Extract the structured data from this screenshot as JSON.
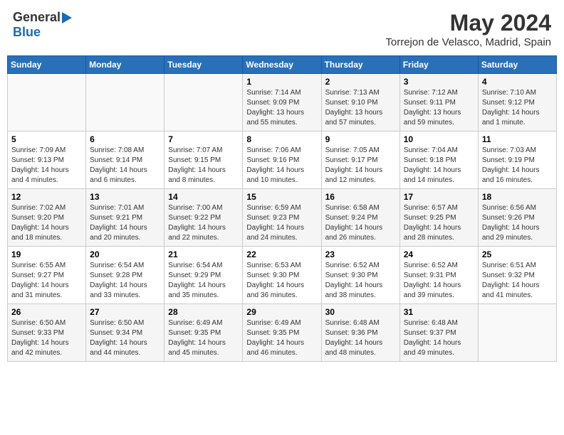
{
  "header": {
    "logo_general": "General",
    "logo_blue": "Blue",
    "month": "May 2024",
    "location": "Torrejon de Velasco, Madrid, Spain"
  },
  "weekdays": [
    "Sunday",
    "Monday",
    "Tuesday",
    "Wednesday",
    "Thursday",
    "Friday",
    "Saturday"
  ],
  "weeks": [
    [
      {
        "day": "",
        "info": ""
      },
      {
        "day": "",
        "info": ""
      },
      {
        "day": "",
        "info": ""
      },
      {
        "day": "1",
        "info": "Sunrise: 7:14 AM\nSunset: 9:09 PM\nDaylight: 13 hours and 55 minutes."
      },
      {
        "day": "2",
        "info": "Sunrise: 7:13 AM\nSunset: 9:10 PM\nDaylight: 13 hours and 57 minutes."
      },
      {
        "day": "3",
        "info": "Sunrise: 7:12 AM\nSunset: 9:11 PM\nDaylight: 13 hours and 59 minutes."
      },
      {
        "day": "4",
        "info": "Sunrise: 7:10 AM\nSunset: 9:12 PM\nDaylight: 14 hours and 1 minute."
      }
    ],
    [
      {
        "day": "5",
        "info": "Sunrise: 7:09 AM\nSunset: 9:13 PM\nDaylight: 14 hours and 4 minutes."
      },
      {
        "day": "6",
        "info": "Sunrise: 7:08 AM\nSunset: 9:14 PM\nDaylight: 14 hours and 6 minutes."
      },
      {
        "day": "7",
        "info": "Sunrise: 7:07 AM\nSunset: 9:15 PM\nDaylight: 14 hours and 8 minutes."
      },
      {
        "day": "8",
        "info": "Sunrise: 7:06 AM\nSunset: 9:16 PM\nDaylight: 14 hours and 10 minutes."
      },
      {
        "day": "9",
        "info": "Sunrise: 7:05 AM\nSunset: 9:17 PM\nDaylight: 14 hours and 12 minutes."
      },
      {
        "day": "10",
        "info": "Sunrise: 7:04 AM\nSunset: 9:18 PM\nDaylight: 14 hours and 14 minutes."
      },
      {
        "day": "11",
        "info": "Sunrise: 7:03 AM\nSunset: 9:19 PM\nDaylight: 14 hours and 16 minutes."
      }
    ],
    [
      {
        "day": "12",
        "info": "Sunrise: 7:02 AM\nSunset: 9:20 PM\nDaylight: 14 hours and 18 minutes."
      },
      {
        "day": "13",
        "info": "Sunrise: 7:01 AM\nSunset: 9:21 PM\nDaylight: 14 hours and 20 minutes."
      },
      {
        "day": "14",
        "info": "Sunrise: 7:00 AM\nSunset: 9:22 PM\nDaylight: 14 hours and 22 minutes."
      },
      {
        "day": "15",
        "info": "Sunrise: 6:59 AM\nSunset: 9:23 PM\nDaylight: 14 hours and 24 minutes."
      },
      {
        "day": "16",
        "info": "Sunrise: 6:58 AM\nSunset: 9:24 PM\nDaylight: 14 hours and 26 minutes."
      },
      {
        "day": "17",
        "info": "Sunrise: 6:57 AM\nSunset: 9:25 PM\nDaylight: 14 hours and 28 minutes."
      },
      {
        "day": "18",
        "info": "Sunrise: 6:56 AM\nSunset: 9:26 PM\nDaylight: 14 hours and 29 minutes."
      }
    ],
    [
      {
        "day": "19",
        "info": "Sunrise: 6:55 AM\nSunset: 9:27 PM\nDaylight: 14 hours and 31 minutes."
      },
      {
        "day": "20",
        "info": "Sunrise: 6:54 AM\nSunset: 9:28 PM\nDaylight: 14 hours and 33 minutes."
      },
      {
        "day": "21",
        "info": "Sunrise: 6:54 AM\nSunset: 9:29 PM\nDaylight: 14 hours and 35 minutes."
      },
      {
        "day": "22",
        "info": "Sunrise: 6:53 AM\nSunset: 9:30 PM\nDaylight: 14 hours and 36 minutes."
      },
      {
        "day": "23",
        "info": "Sunrise: 6:52 AM\nSunset: 9:30 PM\nDaylight: 14 hours and 38 minutes."
      },
      {
        "day": "24",
        "info": "Sunrise: 6:52 AM\nSunset: 9:31 PM\nDaylight: 14 hours and 39 minutes."
      },
      {
        "day": "25",
        "info": "Sunrise: 6:51 AM\nSunset: 9:32 PM\nDaylight: 14 hours and 41 minutes."
      }
    ],
    [
      {
        "day": "26",
        "info": "Sunrise: 6:50 AM\nSunset: 9:33 PM\nDaylight: 14 hours and 42 minutes."
      },
      {
        "day": "27",
        "info": "Sunrise: 6:50 AM\nSunset: 9:34 PM\nDaylight: 14 hours and 44 minutes."
      },
      {
        "day": "28",
        "info": "Sunrise: 6:49 AM\nSunset: 9:35 PM\nDaylight: 14 hours and 45 minutes."
      },
      {
        "day": "29",
        "info": "Sunrise: 6:49 AM\nSunset: 9:35 PM\nDaylight: 14 hours and 46 minutes."
      },
      {
        "day": "30",
        "info": "Sunrise: 6:48 AM\nSunset: 9:36 PM\nDaylight: 14 hours and 48 minutes."
      },
      {
        "day": "31",
        "info": "Sunrise: 6:48 AM\nSunset: 9:37 PM\nDaylight: 14 hours and 49 minutes."
      },
      {
        "day": "",
        "info": ""
      }
    ]
  ]
}
